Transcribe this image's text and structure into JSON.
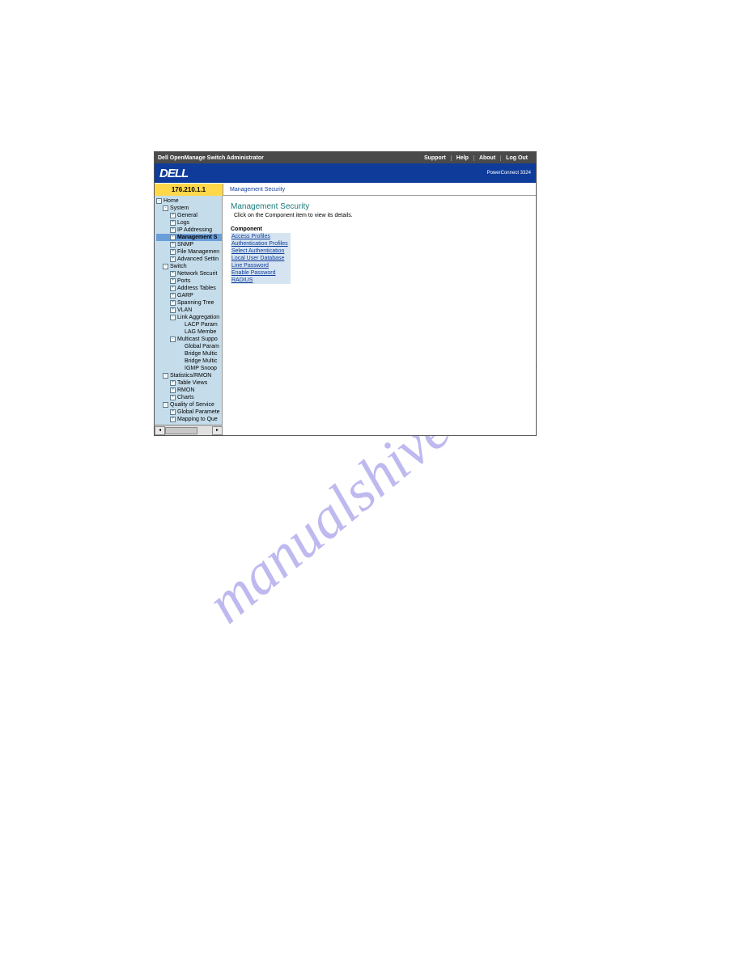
{
  "watermark": "manualshive.com",
  "titlebar": {
    "app_title": "Dell OpenManage Switch Administrator",
    "links": [
      "Support",
      "Help",
      "About",
      "Log Out"
    ]
  },
  "logobar": {
    "logo_text": "DELL",
    "product": "PowerConnect 3324"
  },
  "navstrip": {
    "ip": "176.210.1.1",
    "breadcrumb": "Management Security"
  },
  "tree": [
    {
      "depth": 0,
      "exp": "-",
      "label": "Home",
      "sel": false
    },
    {
      "depth": 1,
      "exp": "-",
      "label": "System",
      "sel": false
    },
    {
      "depth": 2,
      "exp": "+",
      "label": "General",
      "sel": false
    },
    {
      "depth": 2,
      "exp": "+",
      "label": "Logs",
      "sel": false
    },
    {
      "depth": 2,
      "exp": "+",
      "label": "IP Addressing",
      "sel": false
    },
    {
      "depth": 2,
      "exp": "-",
      "label": "Management S",
      "sel": true
    },
    {
      "depth": 2,
      "exp": "+",
      "label": "SNMP",
      "sel": false
    },
    {
      "depth": 2,
      "exp": "+",
      "label": "File Managemen",
      "sel": false
    },
    {
      "depth": 2,
      "exp": "+",
      "label": "Advanced Settin",
      "sel": false
    },
    {
      "depth": 1,
      "exp": "-",
      "label": "Switch",
      "sel": false
    },
    {
      "depth": 2,
      "exp": "+",
      "label": "Network Securit",
      "sel": false
    },
    {
      "depth": 2,
      "exp": "+",
      "label": "Ports",
      "sel": false
    },
    {
      "depth": 2,
      "exp": "+",
      "label": "Address Tables",
      "sel": false
    },
    {
      "depth": 2,
      "exp": "+",
      "label": "GARP",
      "sel": false
    },
    {
      "depth": 2,
      "exp": "+",
      "label": "Spanning Tree",
      "sel": false
    },
    {
      "depth": 2,
      "exp": "+",
      "label": "VLAN",
      "sel": false
    },
    {
      "depth": 2,
      "exp": "-",
      "label": "Link Aggregation",
      "sel": false
    },
    {
      "depth": 3,
      "exp": " ",
      "label": "LACP Param",
      "sel": false
    },
    {
      "depth": 3,
      "exp": " ",
      "label": "LAG Membe",
      "sel": false
    },
    {
      "depth": 2,
      "exp": "-",
      "label": "Multicast Suppo",
      "sel": false
    },
    {
      "depth": 3,
      "exp": " ",
      "label": "Global Param",
      "sel": false
    },
    {
      "depth": 3,
      "exp": " ",
      "label": "Bridge Multic",
      "sel": false
    },
    {
      "depth": 3,
      "exp": " ",
      "label": "Bridge Multic",
      "sel": false
    },
    {
      "depth": 3,
      "exp": " ",
      "label": "IGMP Snoop",
      "sel": false
    },
    {
      "depth": 1,
      "exp": "-",
      "label": "Statistics/RMON",
      "sel": false
    },
    {
      "depth": 2,
      "exp": "+",
      "label": "Table Views",
      "sel": false
    },
    {
      "depth": 2,
      "exp": "+",
      "label": "RMON",
      "sel": false
    },
    {
      "depth": 2,
      "exp": "+",
      "label": "Charts",
      "sel": false
    },
    {
      "depth": 1,
      "exp": "-",
      "label": "Quality of Service",
      "sel": false
    },
    {
      "depth": 2,
      "exp": "+",
      "label": "Global Paramete",
      "sel": false
    },
    {
      "depth": 2,
      "exp": "+",
      "label": "Mapping to Que",
      "sel": false
    }
  ],
  "content": {
    "title": "Management Security",
    "subtitle": "Click on the Component item to view its details.",
    "component_header": "Component",
    "components": [
      "Access Profiles",
      "Authentication Profiles",
      "Select Authentication",
      "Local User Database",
      "Line Password",
      "Enable Password",
      "RADIUS"
    ]
  }
}
